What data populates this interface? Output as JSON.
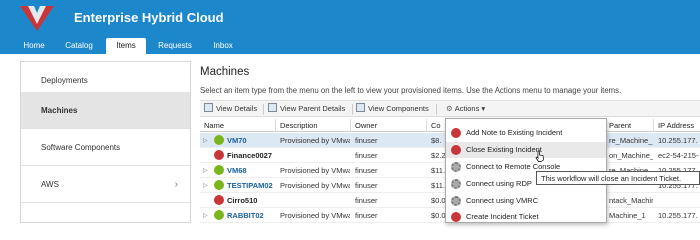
{
  "app": {
    "title": "Enterprise Hybrid Cloud",
    "logo": "vmware-logo"
  },
  "nav": {
    "tabs": [
      {
        "label": "Home"
      },
      {
        "label": "Catalog"
      },
      {
        "label": "Items"
      },
      {
        "label": "Requests"
      },
      {
        "label": "Inbox"
      }
    ],
    "active": "Items"
  },
  "sidebar": {
    "items": [
      {
        "label": "Deployments"
      },
      {
        "label": "Machines"
      },
      {
        "label": "Software Components"
      },
      {
        "label": "AWS"
      }
    ],
    "active": "Machines"
  },
  "main": {
    "title": "Machines",
    "hint": "Select an item type from the menu on the left to view your provisioned items. Use the Actions menu to manage your items."
  },
  "toolbar": {
    "view_details": "View Details",
    "view_parent_details": "View Parent Details",
    "view_components": "View Components",
    "actions": "Actions"
  },
  "grid": {
    "columns": [
      "Name",
      "Description",
      "Owner",
      "Co",
      "Parent",
      "IP Address"
    ],
    "rows": [
      {
        "name": "VM70",
        "description": "Provisioned by VMwa",
        "owner": "finuser",
        "cost": "$8.",
        "parent": "re_Machine_1",
        "ip": "10.255.177.",
        "status": "green",
        "expandable": true,
        "selected": true
      },
      {
        "name": "Finance0027",
        "description": "",
        "owner": "finuser",
        "cost": "$2.2",
        "parent": "on_Machine_1",
        "ip": "ec2-54-215-",
        "status": "red",
        "expandable": false,
        "selected": false
      },
      {
        "name": "VM68",
        "description": "Provisioned by VMwa",
        "owner": "finuser",
        "cost": "$11.",
        "parent": "re_Machine_1",
        "ip": "10.255.177.",
        "status": "green",
        "expandable": true,
        "selected": false
      },
      {
        "name": "TESTIPAM02",
        "description": "Provisioned by VMwa",
        "owner": "finuser",
        "cost": "$11.",
        "parent": "",
        "ip": "10.255.177.",
        "status": "green",
        "expandable": true,
        "selected": false
      },
      {
        "name": "Cirro510",
        "description": "",
        "owner": "finuser",
        "cost": "$0.0",
        "parent": "ntack_Machine_",
        "ip": "",
        "status": "red",
        "expandable": false,
        "selected": false
      },
      {
        "name": "RABBIT02",
        "description": "Provisioned by VMwa",
        "owner": "finuser",
        "cost": "$0.0",
        "parent": "Machine_1",
        "ip": "10.255.177.",
        "status": "green",
        "expandable": true,
        "selected": false
      }
    ]
  },
  "actions_menu": {
    "items": [
      {
        "label": "Add Note to Existing Incident",
        "icon": "red"
      },
      {
        "label": "Close Existing Incident",
        "icon": "red"
      },
      {
        "label": "Connect to Remote Console",
        "icon": "gear"
      },
      {
        "label": "Connect using RDP",
        "icon": "gear"
      },
      {
        "label": "Connect using VMRC",
        "icon": "gear"
      },
      {
        "label": "Create Incident Ticket",
        "icon": "red"
      }
    ],
    "hovered": "Close Existing Incident"
  },
  "tooltip": {
    "text": "This workflow will close an Incident Ticket."
  },
  "colors": {
    "header": "#1d87cc",
    "status_green": "#7ab51d",
    "status_red": "#c8363a",
    "menu_red_icon": "#c8363a"
  }
}
